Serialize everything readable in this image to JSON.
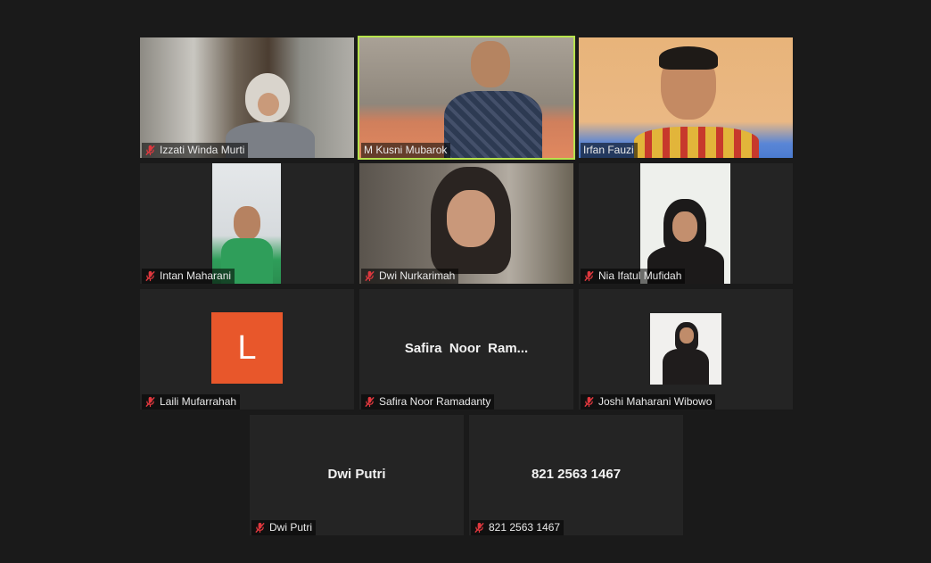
{
  "participants": [
    {
      "name": "Izzati Winda Murti",
      "muted": true
    },
    {
      "name": "M Kusni Mubarok",
      "muted": false,
      "active_speaker": true
    },
    {
      "name": "Irfan Fauzi",
      "muted": false
    },
    {
      "name": "Intan Maharani",
      "muted": true
    },
    {
      "name": "Dwi Nurkarimah",
      "muted": true
    },
    {
      "name": "Nia Ifatul Mufidah",
      "muted": true
    },
    {
      "name": "Laili Mufarrahah",
      "muted": true,
      "avatar_letter": "L",
      "avatar_color": "#e8572b"
    },
    {
      "name": "Safira Noor Ramadanty",
      "muted": true,
      "display_center": "Safira  Noor  Ram..."
    },
    {
      "name": "Joshi Maharani Wibowo",
      "muted": true
    },
    {
      "name": "Dwi Putri",
      "muted": true,
      "display_center": "Dwi Putri"
    },
    {
      "name": "821 2563 1467",
      "muted": true,
      "display_center": "821 2563 1467"
    }
  ],
  "colors": {
    "background": "#1a1a1a",
    "tile": "#242424",
    "speaker_outline": "#b7e34c",
    "mute_icon": "#e0383e"
  },
  "icons": {
    "mute": "muted-microphone-icon"
  }
}
